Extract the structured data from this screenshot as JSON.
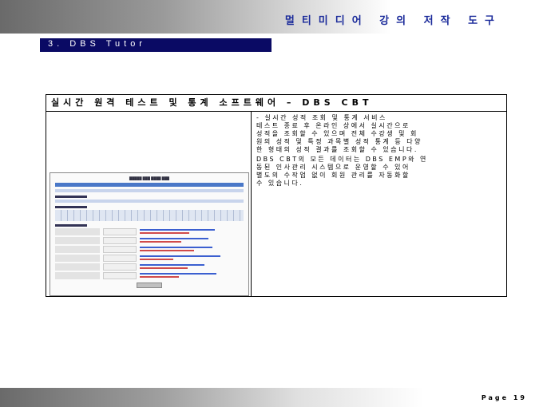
{
  "header": {
    "title": "멀티미디어 강의 저작 도구"
  },
  "section": {
    "label": "3. DBS Tutor"
  },
  "box": {
    "heading": "실시간 원격 테스트 및 통계 소프트웨어 – DBS CBT",
    "description": [
      "- 실시간 성적 조회 및 통계 서비스\n테스트 종료 후 온라인 상에서 실시간으로\n성적을 조회할 수 있으며 전체 수강생 및 회\n원의 성적 및 특정 과목별 성적 통계 등 다양\n한 형태의 성적 결과를 조회할 수 있습니다.",
      "DBS CBT의 모든 데이터는 DBS EMP와 연\n동된 인사관리 시스템으로 운영할 수 있어\n별도의 수작업 없이 회원 관리를 자동화할\n수 있습니다."
    ],
    "screenshot_bars": [
      [
        0.72,
        0.48
      ],
      [
        0.66,
        0.4
      ],
      [
        0.7,
        0.52
      ],
      [
        0.78,
        0.32
      ],
      [
        0.62,
        0.46
      ],
      [
        0.74,
        0.38
      ]
    ]
  },
  "footer": {
    "page": "Page 19"
  }
}
